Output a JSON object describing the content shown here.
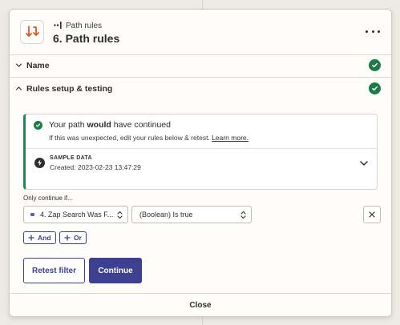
{
  "header": {
    "breadcrumb": "Path rules",
    "title": "6. Path rules"
  },
  "sections": {
    "name": {
      "label": "Name",
      "complete": true
    },
    "rules": {
      "label": "Rules setup & testing",
      "complete": true
    }
  },
  "status": {
    "prefix": "Your path ",
    "emphasis": "would",
    "suffix": " have continued",
    "subtext": "If this was unexpected, edit your rules below & retest.",
    "link": "Learn more."
  },
  "sample": {
    "label": "SAMPLE DATA",
    "created": "Created: 2023-02-23 13:47:29"
  },
  "filter": {
    "label": "Only continue if...",
    "field_value": "4. Zap Search Was F...",
    "condition_value": "(Boolean) Is true"
  },
  "buttons": {
    "and": "And",
    "or": "Or",
    "retest": "Retest filter",
    "continue": "Continue",
    "close": "Close"
  },
  "colors": {
    "accent": "#3d3f8f",
    "success": "#1e7a46",
    "brand_orange": "#e8561f"
  }
}
